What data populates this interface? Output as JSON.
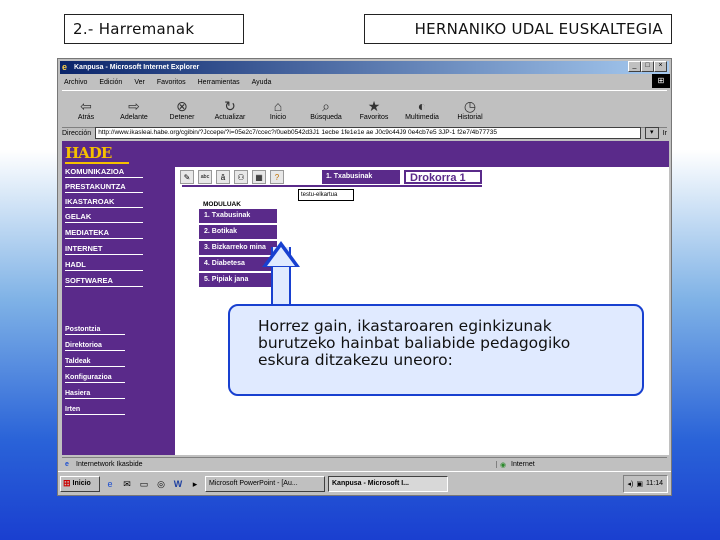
{
  "slide": {
    "title_left": "2.- Harremanak",
    "title_right": "HERNANIKO UDAL EUSKALTEGIA",
    "callout_lines": [
      "Horrez gain, ikastaroaren eginkizunak",
      "burutzeko hainbat baliabide pedagogiko",
      "eskura ditzakezu uneoro:"
    ]
  },
  "browser": {
    "window_title": "Kanpusa - Microsoft Internet Explorer",
    "menu": [
      "Archivo",
      "Edición",
      "Ver",
      "Favoritos",
      "Herramientas",
      "Ayuda"
    ],
    "toolbar": [
      {
        "label": "Atrás",
        "icon": "back-arrow-icon"
      },
      {
        "label": "Adelante",
        "icon": "forward-arrow-icon"
      },
      {
        "label": "Detener",
        "icon": "stop-icon"
      },
      {
        "label": "Actualizar",
        "icon": "refresh-icon"
      },
      {
        "label": "Inicio",
        "icon": "home-icon"
      },
      {
        "label": "Búsqueda",
        "icon": "search-icon"
      },
      {
        "label": "Favoritos",
        "icon": "favorites-icon"
      },
      {
        "label": "Multimedia",
        "icon": "media-icon"
      },
      {
        "label": "Historial",
        "icon": "history-icon"
      }
    ],
    "address_label": "Dirección",
    "address_value": "http://www.ikasleai.habe.org/cgibin/?Jccepe/?i=05e2c7/ccec?/0ueb0542d3J1 1ecbe 1fe1e1e ae J0c9c44J9 0e4cb7e5 3JP-1 f2e7/4b77735",
    "go_label": "Ir"
  },
  "page": {
    "logo": "HADE",
    "side_main": [
      "KOMUNIKAZIOA",
      "PRESTAKUNTZA",
      "IKASTAROAK",
      "GELAK",
      "MEDIATEKA",
      "INTERNET",
      "HADL",
      "SOFTWAREA"
    ],
    "side_sub": [
      "Postontzia",
      "Direktorioa",
      "Taldeak",
      "Konfigurazioa",
      "Hasiera",
      "Irten"
    ],
    "active_tab": "1. Txabusinak",
    "drokorra_tab": "Drokorra 1",
    "moduluak_header": "MODULUAK",
    "modules": [
      "1. Txabusinak",
      "2. Botikak",
      "3. Bizkarreko mina",
      "4. Diabetesa",
      "5. Pipiak jana"
    ],
    "search_text": "testu-elkartua"
  },
  "status": {
    "left": "Internetwork Ikasbide",
    "right": "Internet"
  },
  "taskbar": {
    "start": "Inicio",
    "task1": "Microsoft PowerPoint - [Au...",
    "task2": "Kanpusa - Microsoft I...",
    "clock": "11:14"
  }
}
